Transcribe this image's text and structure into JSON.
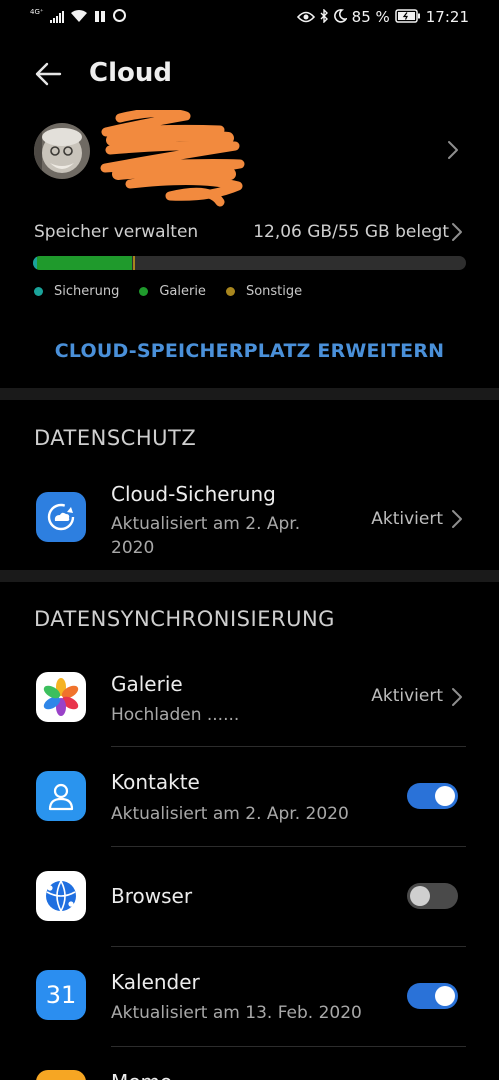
{
  "status_bar": {
    "network_label": "4G⁺",
    "battery_percent": "85 %",
    "time": "17:21"
  },
  "header": {
    "title": "Cloud"
  },
  "storage": {
    "label": "Speicher verwalten",
    "value": "12,06 GB/55 GB belegt",
    "used_fraction_backup": 0.01,
    "used_fraction_gallery": 0.22,
    "used_fraction_other": 0.005,
    "legend": [
      {
        "label": "Sicherung",
        "color": "#1aa39a"
      },
      {
        "label": "Galerie",
        "color": "#1f9a2c"
      },
      {
        "label": "Sonstige",
        "color": "#a8861e"
      }
    ]
  },
  "expand_label": "CLOUD-SPEICHERPLATZ ERWEITERN",
  "privacy": {
    "header": "DATENSCHUTZ",
    "backup": {
      "title": "Cloud-Sicherung",
      "subtitle_line1": "Aktualisiert am 2. Apr.",
      "subtitle_line2": "2020",
      "status": "Aktiviert"
    }
  },
  "sync": {
    "header": "DATENSYNCHRONISIERUNG",
    "items": [
      {
        "title": "Galerie",
        "subtitle": "Hochladen ......",
        "status": "Aktiviert"
      },
      {
        "title": "Kontakte",
        "subtitle": "Aktualisiert am 2. Apr. 2020",
        "enabled": true
      },
      {
        "title": "Browser",
        "enabled": false
      },
      {
        "title": "Kalender",
        "subtitle": "Aktualisiert am 13. Feb. 2020",
        "enabled": true,
        "icon_text": "31"
      },
      {
        "title": "Memo"
      }
    ]
  },
  "colors": {
    "accent": "#4a90d9",
    "toggle_on": "#2a72d8"
  }
}
